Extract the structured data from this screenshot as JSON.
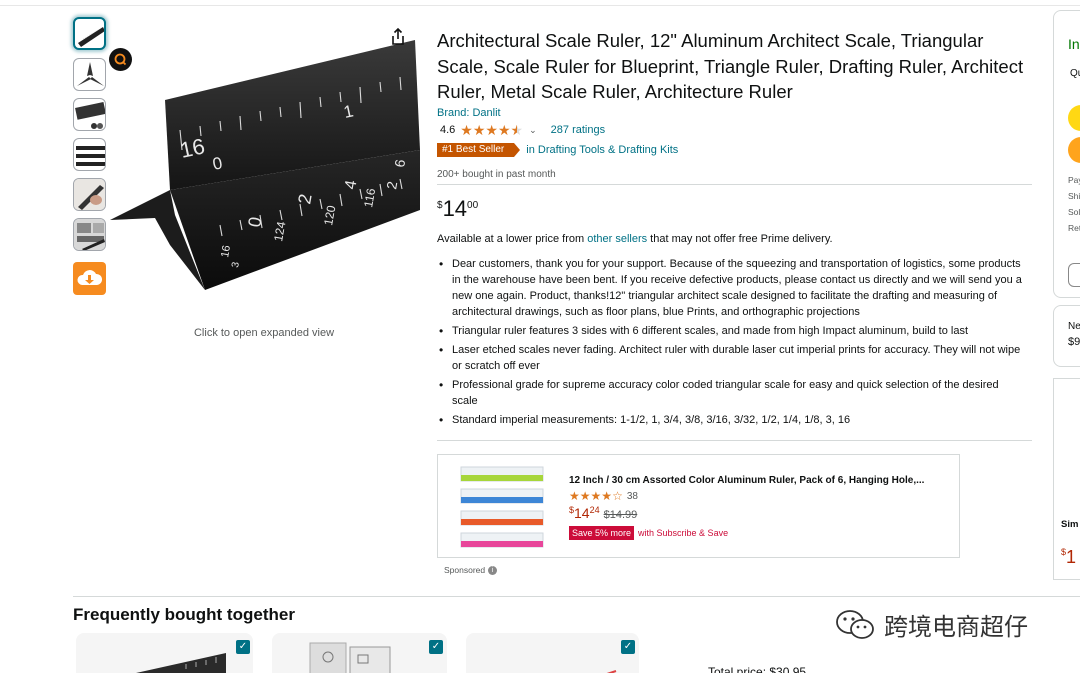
{
  "product": {
    "title": "Architectural Scale Ruler, 12\" Aluminum Architect Scale, Triangular Scale, Scale Ruler for Blueprint, Triangle Ruler, Drafting Ruler, Architect Ruler, Metal Scale Ruler, Architecture Ruler",
    "brand_label": "Brand: Danlit",
    "rating_value": "4.6",
    "stars": 4.5,
    "ratings_count": "287 ratings",
    "best_seller_badge": "#1 Best Seller",
    "best_seller_category": "in Drafting Tools & Drafting Kits",
    "bought_text": "200+ bought in past month",
    "price_symbol": "$",
    "price_whole": "14",
    "price_fraction": "00",
    "lower_price_prefix": "Available at a lower price from ",
    "lower_price_link": "other sellers",
    "lower_price_suffix": " that may not offer free Prime delivery.",
    "bullets": [
      "Dear customers, thank you for your support. Because of the squeezing and transportation of logistics, some products in the warehouse have been bent. If you receive defective products, please contact us directly and we will send you a new one again. Product, thanks!12\" triangular architect scale designed to facilitate the drafting and measuring of architectural drawings, such as floor plans, blue Prints, and orthographic projections",
      "Triangular ruler features 3 sides with 6 different scales, and made from high Impact aluminum, build to last",
      "Laser etched scales never fading. Architect ruler with durable laser cut imperial prints for accuracy. They will not wipe or scratch off ever",
      "Professional grade for supreme accuracy color coded triangular scale for easy and quick selection of the desired scale",
      "Standard imperial measurements: 1-1/2, 1, 3/4, 3/8, 3/16, 3/32, 1/2, 1/4, 1/8, 3, 16"
    ]
  },
  "gallery": {
    "expand_hint": "Click to open expanded view",
    "thumbnails": [
      "ruler",
      "triangle-profile",
      "scale-detail",
      "three-rulers",
      "hand-drawing",
      "blueprint",
      "cloud-download"
    ],
    "hero_scale_labels": [
      "16",
      "0",
      "1",
      "2",
      "4",
      "0",
      "124",
      "120",
      "116",
      "16",
      "3",
      "2",
      "6"
    ]
  },
  "sponsored": {
    "title": "12 Inch / 30 cm Assorted Color Aluminum Ruler, Pack of 6, Hanging Hole,...",
    "stars": 4,
    "review_count": "38",
    "price_symbol": "$",
    "price_whole": "14",
    "price_fraction": "24",
    "list_price": "$14.99",
    "save_badge": "Save 5% more",
    "subscribe_label": "with Subscribe & Save",
    "label": "Sponsored",
    "ruler_colors": [
      "#a7d63a",
      "#3d86d6",
      "#e85a2a",
      "#e8469a"
    ]
  },
  "buybox": {
    "stock_fragment": "In",
    "qty_fragment": "Qu",
    "small_fragments": [
      "Pay",
      "Shi",
      "Sol",
      "Ret"
    ],
    "button_colors": [
      "#ffd814",
      "#ffa41c"
    ]
  },
  "new_used": {
    "label_fragment": "Ne",
    "price_fragment": "$9"
  },
  "side_ad": {
    "title_fragment": "Sim Blac",
    "price_fragment": "1"
  },
  "fbt": {
    "title": "Frequently bought together",
    "total_fragment": "Total price: $30.95"
  },
  "watermark": {
    "text": "跨境电商超仔"
  },
  "colors": {
    "link": "#007185",
    "badge": "#c45500",
    "price_red": "#b12704",
    "save_red": "#cc0c39",
    "star": "#de7921"
  }
}
